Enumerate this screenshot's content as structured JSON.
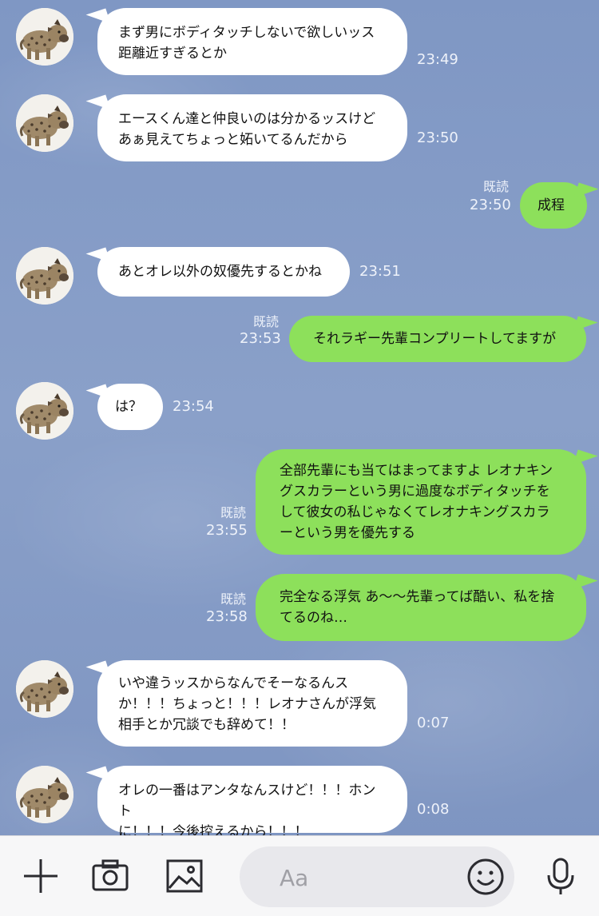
{
  "messages": [
    {
      "side": "in",
      "text": "まず男にボディタッチしないで欲しいッス\n距離近すぎるとか",
      "time": "23:49"
    },
    {
      "side": "in",
      "text": "エースくん達と仲良いのは分かるッスけど\nあぁ見えてちょっと妬いてるんだから",
      "time": "23:50"
    },
    {
      "side": "out",
      "text": "成程",
      "time": "23:50",
      "read": "既読"
    },
    {
      "side": "in",
      "text": "あとオレ以外の奴優先するとかね",
      "time": "23:51"
    },
    {
      "side": "out",
      "text": "それラギー先輩コンプリートしてますが",
      "time": "23:53",
      "read": "既読"
    },
    {
      "side": "in",
      "text": "は？",
      "time": "23:54"
    },
    {
      "side": "out",
      "text": "全部先輩にも当てはまってますよ レオナキン\nグスカラーという男に過度なボディタッチを\nして彼女の私じゃなくてレオナキングスカラ\nーという男を優先する",
      "time": "23:55",
      "read": "既読"
    },
    {
      "side": "out",
      "text": "完全なる浮気 あ〜〜先輩ってば酷い、私を捨\nてるのね…",
      "time": "23:58",
      "read": "既読"
    },
    {
      "side": "in",
      "text": "いや違うッスからなんでそーなるんス\nか！！！ちょっと！！！レオナさんが浮気\n相手とか冗談でも辞めて！！",
      "time": "0:07"
    },
    {
      "side": "in",
      "text": "オレの一番はアンタなんスけど！！！ホント\nに！！！今後控えるから！！！",
      "time": "0:08"
    }
  ],
  "toolbar": {
    "input_placeholder": "Aa",
    "icons": [
      "plus-icon",
      "camera-icon",
      "image-icon",
      "emoji-icon",
      "microphone-icon"
    ]
  },
  "colors": {
    "background": "#8aa0c9",
    "incoming_bubble": "#ffffff",
    "outgoing_bubble": "#8de05b",
    "meta_text": "#eef2fa"
  }
}
